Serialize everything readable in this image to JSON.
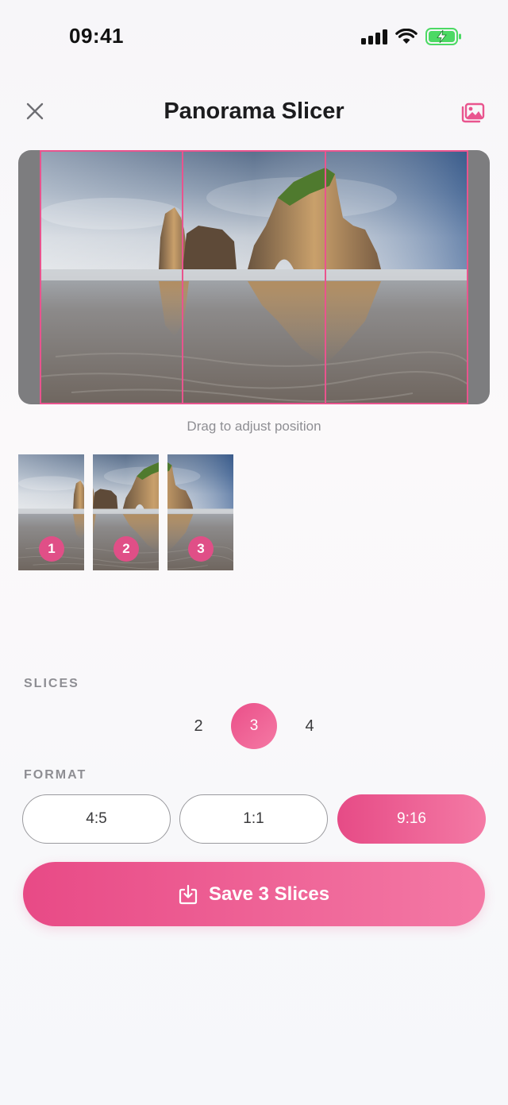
{
  "status_bar": {
    "time": "09:41",
    "icons": [
      "signal-icon",
      "wifi-icon",
      "battery-charging-icon"
    ]
  },
  "header": {
    "title": "Panorama Slicer",
    "close_icon": "close-icon",
    "gallery_icon": "photo-library-icon"
  },
  "panorama": {
    "hint": "Drag to adjust position",
    "slice_count": 3
  },
  "thumbnails": [
    {
      "number": "1"
    },
    {
      "number": "2"
    },
    {
      "number": "3"
    }
  ],
  "slices": {
    "label": "SLICES",
    "options": [
      "2",
      "3",
      "4"
    ],
    "selected": "3"
  },
  "format": {
    "label": "FORMAT",
    "options": [
      "4:5",
      "1:1",
      "9:16"
    ],
    "selected": "9:16"
  },
  "save_button": {
    "label": "Save 3 Slices",
    "icon": "save-download-icon"
  },
  "colors": {
    "accent": "#e9548e",
    "accent_light": "#f579a4"
  }
}
